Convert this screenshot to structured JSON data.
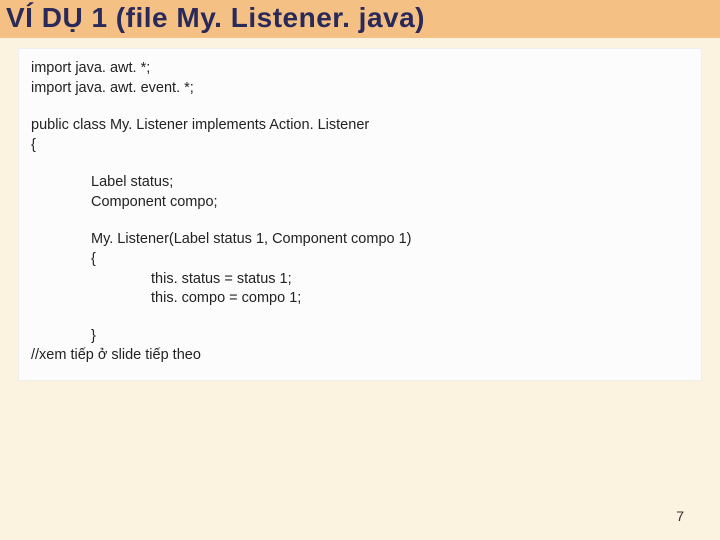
{
  "title": "VÍ DỤ 1 (file My. Listener. java)",
  "code": {
    "l01": "import java. awt. *;",
    "l02": "import java. awt. event. *;",
    "l03": "public class My. Listener implements Action. Listener",
    "l04": "{",
    "l05": "Label status;",
    "l06": "Component compo;",
    "l07": "My. Listener(Label status 1, Component compo 1)",
    "l08": "{",
    "l09": "this. status = status 1;",
    "l10": "this. compo = compo 1;",
    "l11": "}",
    "l12": "//xem tiếp ở slide tiếp theo"
  },
  "page_number": "7"
}
